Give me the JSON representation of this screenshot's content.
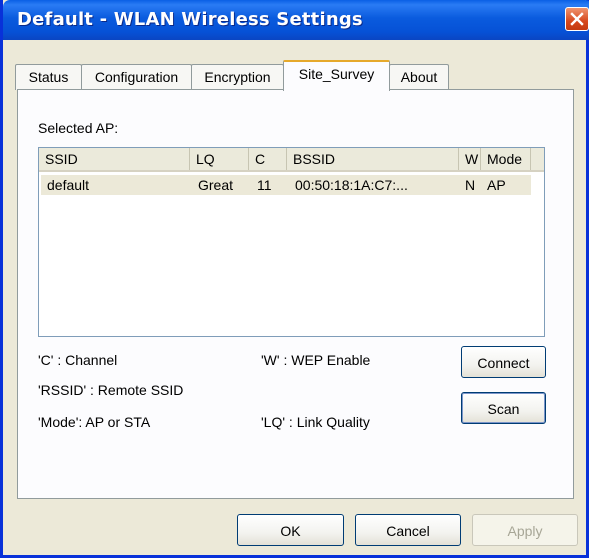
{
  "window": {
    "title": "Default - WLAN Wireless Settings"
  },
  "tabs": [
    {
      "label": "Status",
      "active": false
    },
    {
      "label": "Configuration",
      "active": false
    },
    {
      "label": "Encryption",
      "active": false
    },
    {
      "label": "Site_Survey",
      "active": true
    },
    {
      "label": "About",
      "active": false
    }
  ],
  "site_survey": {
    "selected_ap_label": "Selected AP:",
    "columns": [
      "SSID",
      "LQ",
      "C",
      "BSSID",
      "W",
      "Mode"
    ],
    "rows": [
      {
        "ssid": "default",
        "lq": "Great",
        "c": "11",
        "bssid": "00:50:18:1A:C7:...",
        "w": "N",
        "mode": "AP"
      }
    ],
    "legend": {
      "c": "'C' : Channel",
      "w": "'W' : WEP Enable",
      "rssid": "'RSSID' : Remote SSID",
      "mode": "'Mode': AP or STA",
      "lq": "'LQ' : Link Quality"
    },
    "connect_label": "Connect",
    "scan_label": "Scan"
  },
  "footer": {
    "ok_label": "OK",
    "cancel_label": "Cancel",
    "apply_label": "Apply"
  },
  "colors": {
    "titlebar": "#0a5bde",
    "close": "#d6481d",
    "selected_row": "#ece9d8",
    "tab_highlight": "#e6a92b"
  },
  "icons": {
    "close": "close-icon"
  }
}
